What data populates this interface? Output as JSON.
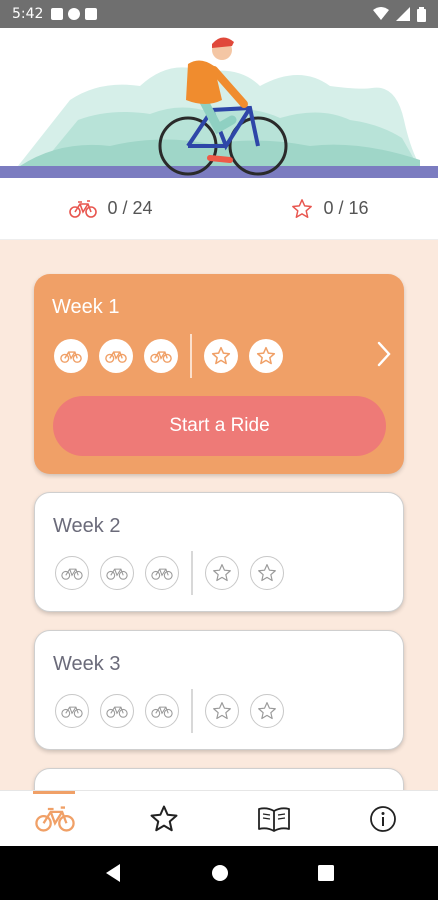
{
  "status_bar": {
    "time": "5:42"
  },
  "stats": {
    "rides": "0 / 24",
    "stars": "0 / 16"
  },
  "weeks": [
    {
      "title": "Week 1",
      "ride_badges": 3,
      "star_badges": 2,
      "active": true
    },
    {
      "title": "Week 2",
      "ride_badges": 3,
      "star_badges": 2,
      "active": false
    },
    {
      "title": "Week 3",
      "ride_badges": 3,
      "star_badges": 2,
      "active": false
    }
  ],
  "start_button": {
    "label": "Start a Ride"
  },
  "colors": {
    "accent": "#f0a067",
    "button": "#ee7a77",
    "stat_icon": "#e8564f"
  },
  "icons": {
    "nav": [
      "bike-icon",
      "star-icon",
      "book-icon",
      "info-icon"
    ]
  }
}
